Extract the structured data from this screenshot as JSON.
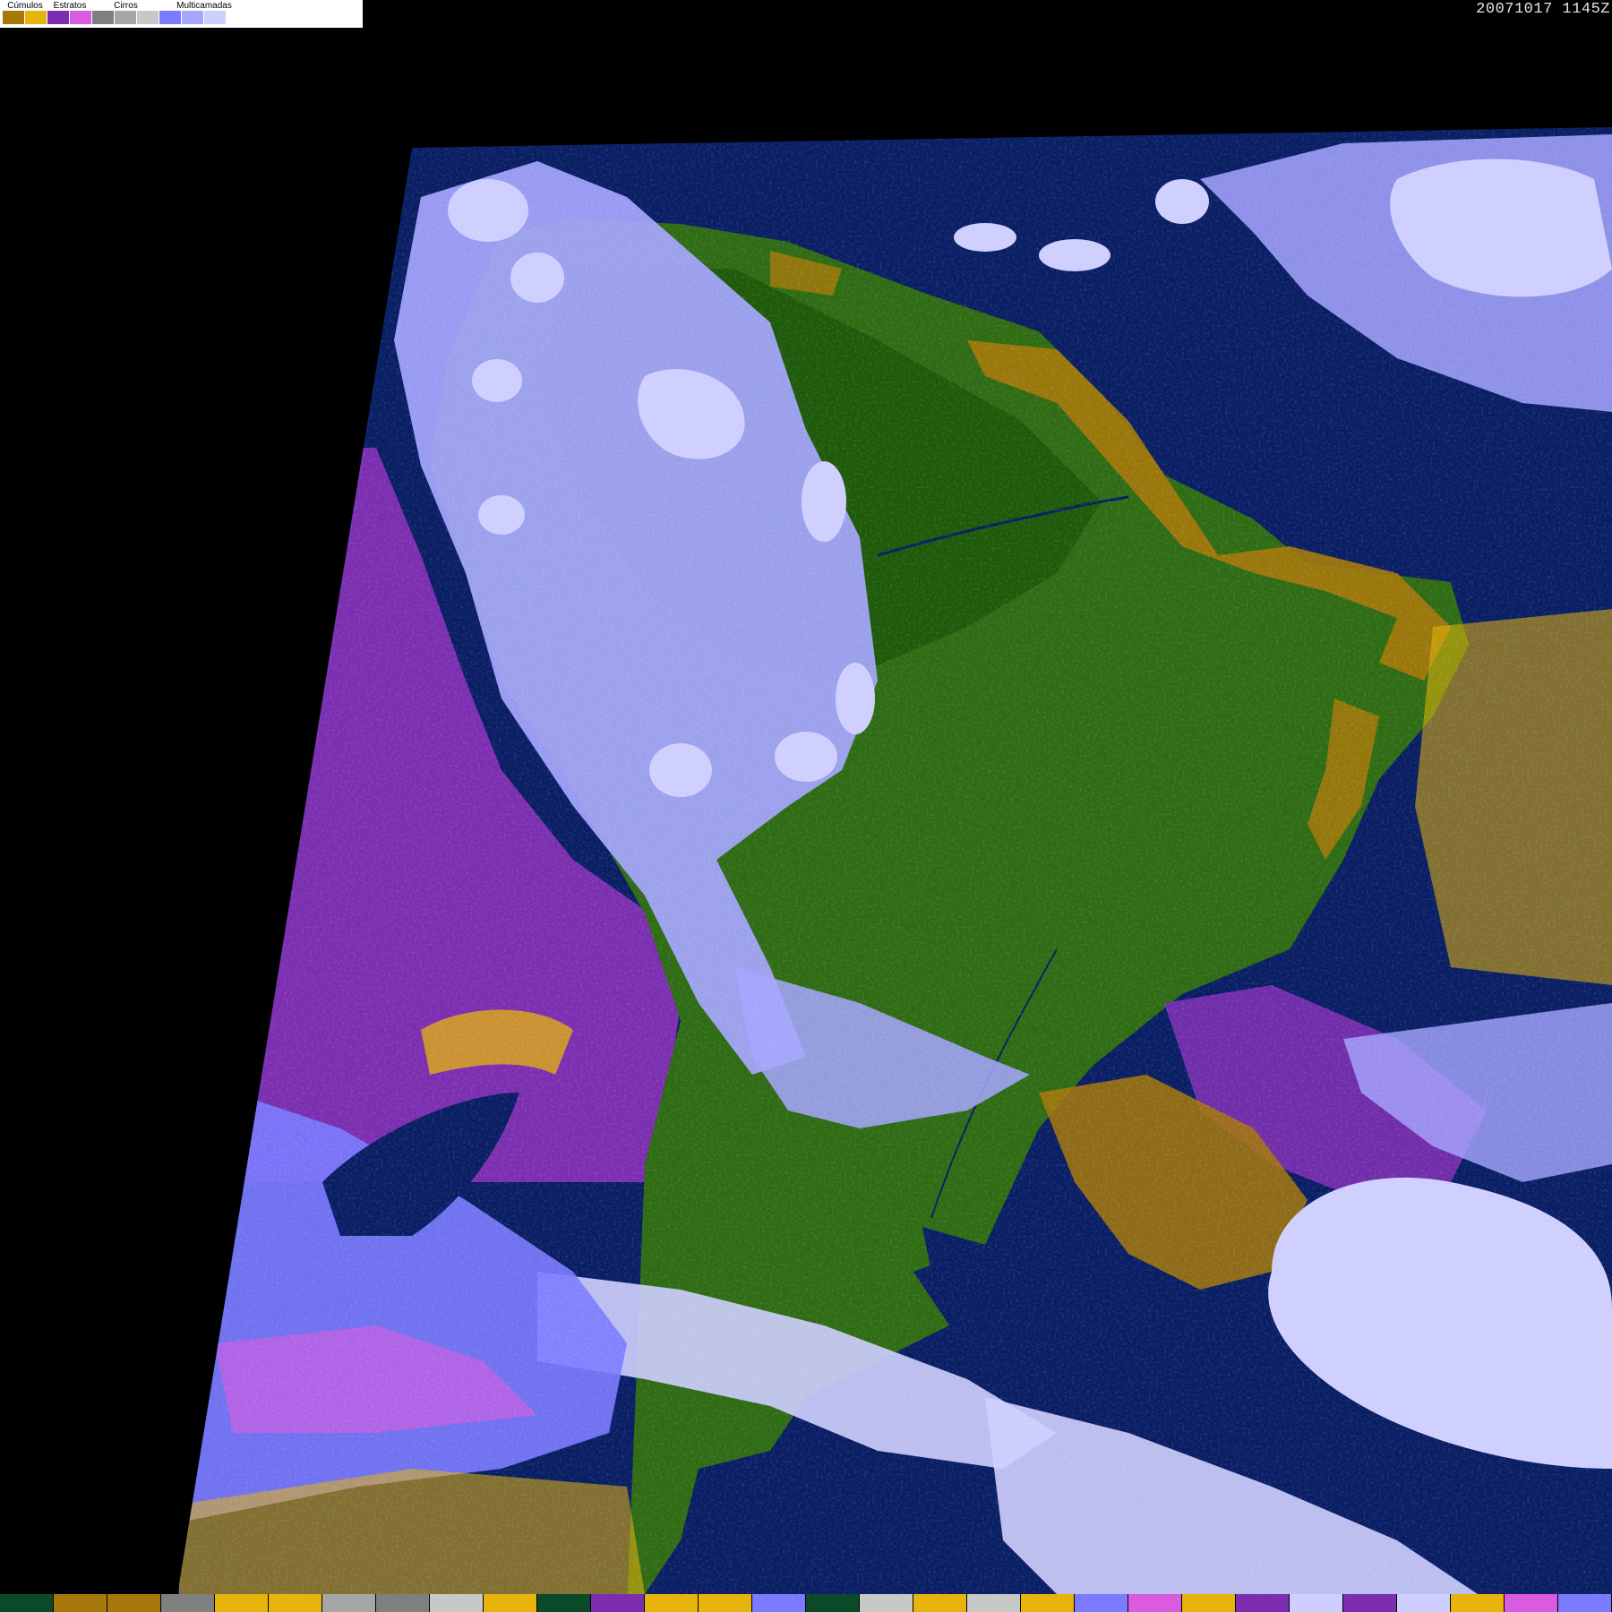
{
  "legend": {
    "groups": [
      {
        "label": "Cúmulos",
        "colors": [
          "#a6790a",
          "#e6b40a"
        ]
      },
      {
        "label": "Estratos",
        "colors": [
          "#7b2fb0",
          "#d85be0"
        ]
      },
      {
        "label": "Cirros",
        "colors": [
          "#7f7f7f",
          "#a6a6a6",
          "#c8c8c8"
        ]
      },
      {
        "label": "Multicamadas",
        "colors": [
          "#7b7bff",
          "#a6a6ff",
          "#cfcfff",
          "#ffffff"
        ]
      }
    ]
  },
  "timestamp": "20071017  1145Z",
  "colors": {
    "background": "#000000",
    "ocean": "#0a1e64",
    "land": "#2f6b14",
    "forest": "#1e5a0a",
    "stratus": "#7b2fb0",
    "stratus_light": "#d85be0",
    "cumulus": "#a6790a",
    "cumulus_light": "#e6b40a",
    "cirrus": "#a6a6a6",
    "multilayer": "#7b7bff",
    "multilayer_light": "#cfcfff"
  },
  "bottom_strip": [
    "#0a4a2a",
    "#a6790a",
    "#a6790a",
    "#7f7f7f",
    "#e6b40a",
    "#e6b40a",
    "#a6a6a6",
    "#7f7f7f",
    "#c8c8c8",
    "#e6b40a",
    "#0a4a2a",
    "#7b2fb0",
    "#e6b40a",
    "#e6b40a",
    "#7b7bff",
    "#0a4a2a",
    "#c8c8c8",
    "#e6b40a",
    "#c8c8c8",
    "#e6b40a",
    "#7b7bff",
    "#d85be0",
    "#e6b40a",
    "#7b2fb0",
    "#cfcfff",
    "#7b2fb0",
    "#cfcfff",
    "#e6b40a",
    "#d85be0",
    "#7b7bff"
  ]
}
